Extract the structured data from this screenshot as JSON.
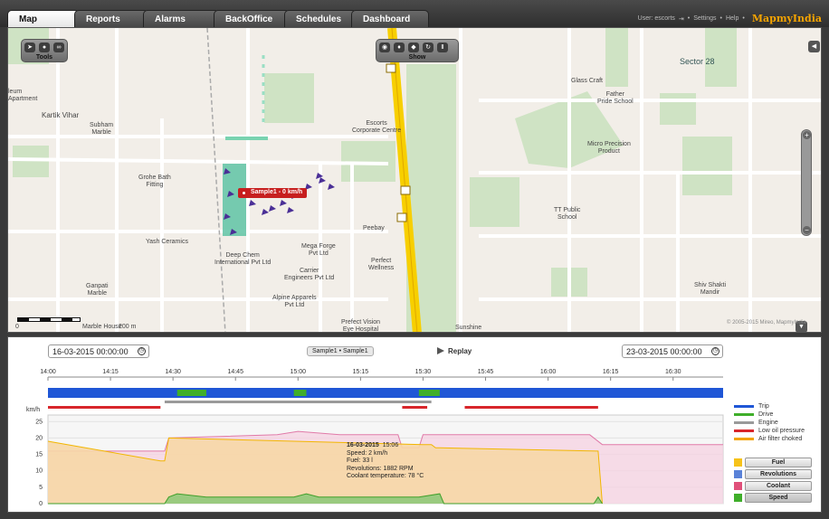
{
  "tabs": [
    {
      "label": "Map",
      "active": true
    },
    {
      "label": "Reports"
    },
    {
      "label": "Alarms"
    },
    {
      "label": "BackOffice"
    },
    {
      "label": "Schedules"
    },
    {
      "label": "Dashboard"
    }
  ],
  "userbar": {
    "user": "User: escorts",
    "settings": "Settings",
    "help": "Help",
    "logo": "MapmyIndia"
  },
  "map": {
    "tools_label": "Tools",
    "show_label": "Show",
    "vehicle_label": "Sample1 - 0 km/h",
    "scale_labels": [
      "0",
      "200 m"
    ],
    "copyright": "© 2005-2015 Mireo, MapmyIndia",
    "labels": {
      "sector28": "Sector 28",
      "apartment": "leum\nApartment",
      "kartik": "Kartik Vihar",
      "subham": "Subham\nMarble",
      "grohe": "Grohe Bath\nFitting",
      "yash": "Yash Ceramics",
      "ganpati": "Ganpati\nMarble",
      "marblehouse": "Marble House",
      "escorts": "Escorts\nCorporate Centre",
      "deepchem": "Deep Chem\nInternational Pvt Ltd",
      "megaforge": "Mega Forge\nPvt Ltd",
      "carrier": "Carrier\nEngineers Pvt Ltd",
      "alpine": "Alpine Apparels\nPvt Ltd",
      "peebay": "Peebay",
      "perfect": "Perfect\nWellness",
      "prefect": "Prefect Vision\nEye Hospital",
      "sunshine": "Sunshine",
      "glass": "Glass Craft",
      "father": "Father\nPride School",
      "micro": "Micro Precision\nProduct",
      "ttpublic": "TT Public\nSchool",
      "shiv": "Shiv Shakti\nMandir"
    }
  },
  "panel": {
    "start_date": "16-03-2015 00:00:00",
    "end_date": "23-03-2015 00:00:00",
    "vehicle_select": "Sample1 • Sample1",
    "replay_label": "Replay",
    "legend": [
      {
        "label": "Trip",
        "color": "#1f56d6"
      },
      {
        "label": "Drive",
        "color": "#3fae2a"
      },
      {
        "label": "Engine",
        "color": "#9a9a9a"
      },
      {
        "label": "Low oil pressure",
        "color": "#d8262b"
      },
      {
        "label": "Air filter choked",
        "color": "#f2a400"
      }
    ],
    "buttons": [
      {
        "label": "Fuel",
        "color": "#f6c21a"
      },
      {
        "label": "Revolutions",
        "color": "#5a82d8"
      },
      {
        "label": "Coolant",
        "color": "#e0507a"
      },
      {
        "label": "Speed",
        "color": "#3fae2a"
      }
    ],
    "tooltip": {
      "title": "16-03-2015",
      "time": "15:06",
      "lines": [
        "Speed: 2 km/h",
        "Fuel: 33 l",
        "Revolutions: 1882 RPM",
        "Coolant temperature: 78 °C"
      ]
    }
  },
  "chart_data": {
    "type": "area",
    "time_ticks": [
      "14:00",
      "14:15",
      "14:30",
      "14:45",
      "15:00",
      "15:15",
      "15:30",
      "15:45",
      "16:00",
      "16:15",
      "16:30"
    ],
    "ylabel": "km/h",
    "yticks": [
      0,
      5,
      10,
      15,
      20,
      25
    ],
    "ylim": [
      0,
      27
    ],
    "xlim_minutes": [
      0,
      162
    ],
    "timeline_bars": {
      "trip": [
        [
          0,
          162
        ]
      ],
      "drive": [
        [
          31,
          38
        ],
        [
          59,
          62
        ],
        [
          89,
          94
        ]
      ],
      "engine": [
        [
          28,
          92
        ]
      ],
      "low_oil_pressure": [
        [
          0,
          27
        ],
        [
          85,
          91
        ],
        [
          100,
          132
        ]
      ]
    },
    "series": [
      {
        "name": "Fuel",
        "x": [
          0,
          27,
          28,
          29,
          90,
          92,
          93,
          94,
          132,
          133
        ],
        "y": [
          19,
          13,
          13,
          20,
          18,
          18,
          17,
          17,
          16,
          0
        ]
      },
      {
        "name": "Coolant",
        "x": [
          0,
          27,
          28,
          29,
          55,
          60,
          70,
          80,
          84,
          85,
          89,
          90,
          100,
          110,
          120,
          130,
          133,
          162
        ],
        "y": [
          16,
          16,
          16,
          20,
          21,
          22,
          21,
          21,
          21,
          17,
          17,
          21,
          21,
          21,
          21,
          21,
          18,
          18
        ]
      },
      {
        "name": "Speed",
        "x": [
          0,
          28,
          29,
          31,
          38,
          40,
          59,
          62,
          65,
          89,
          94,
          95,
          131,
          132,
          133
        ],
        "y": [
          0,
          0,
          2,
          3,
          2,
          2,
          2,
          3,
          2,
          2,
          3,
          0,
          0,
          2,
          0
        ]
      }
    ]
  }
}
